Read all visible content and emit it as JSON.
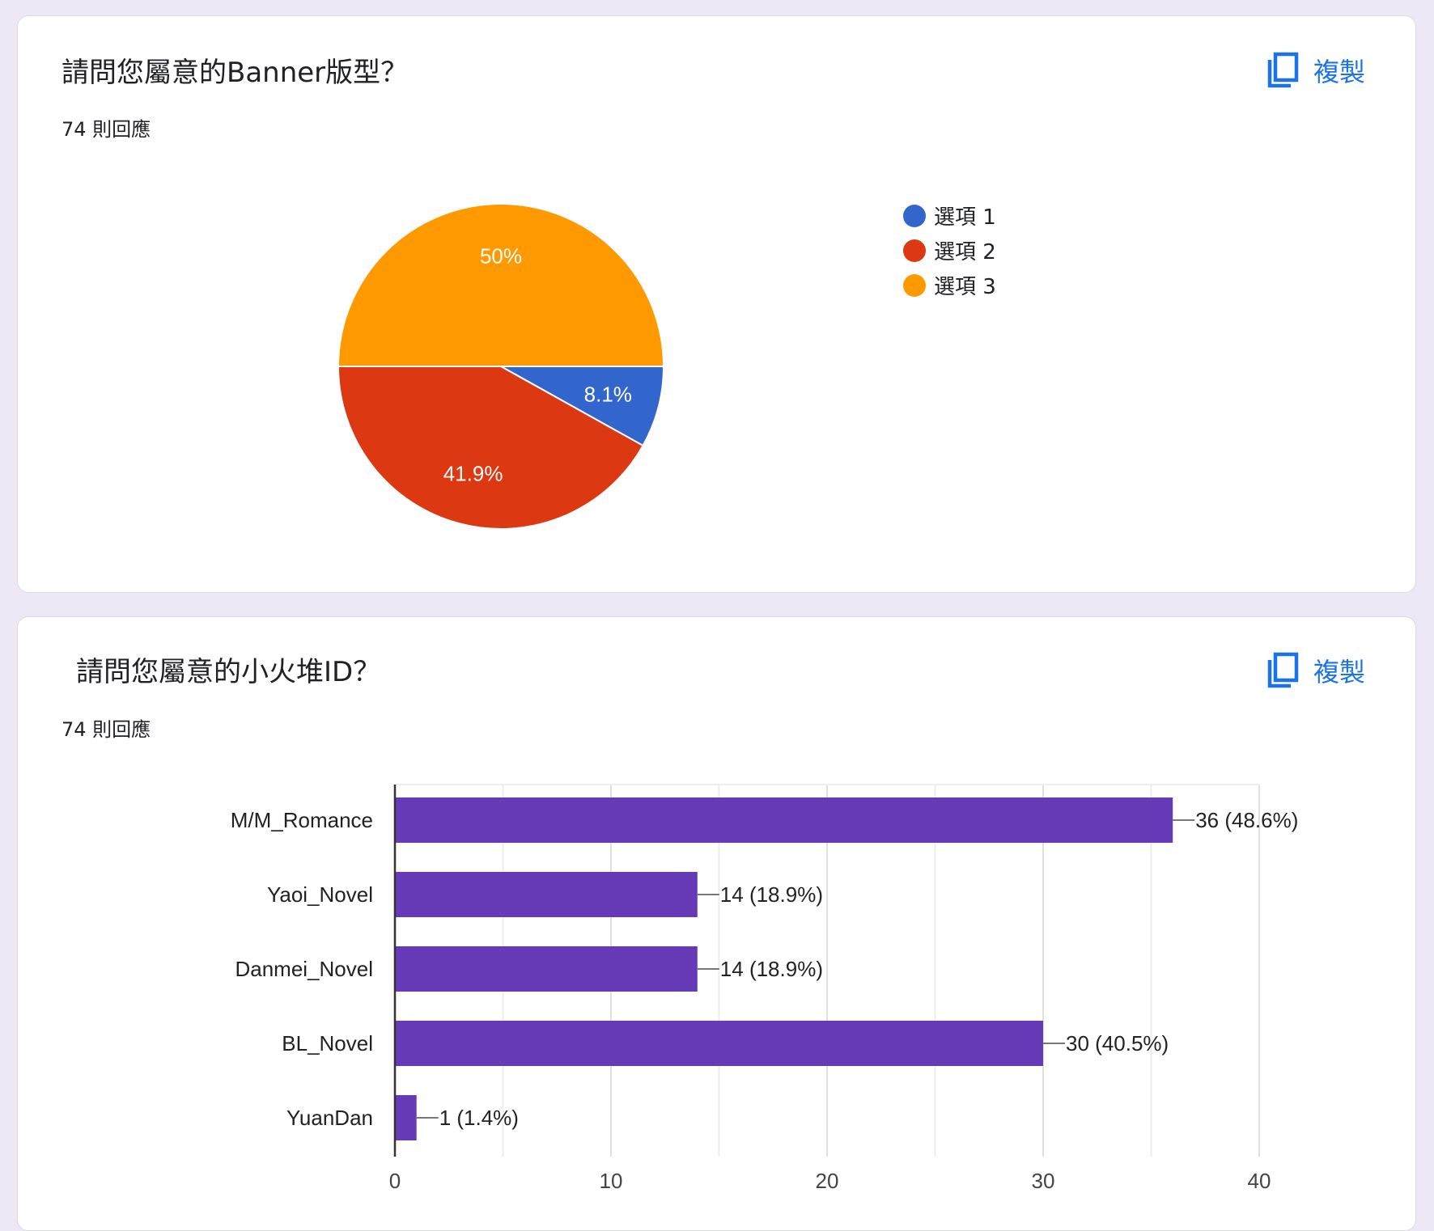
{
  "cards": [
    {
      "title": "請問您屬意的Banner版型？",
      "responses": "74 則回應",
      "copy_label": "複製",
      "chart_data": {
        "type": "pie",
        "slices": [
          {
            "label": "選項 1",
            "value": 8.1,
            "display": "8.1%",
            "color": "#3366cc"
          },
          {
            "label": "選項 2",
            "value": 41.9,
            "display": "41.9%",
            "color": "#dc3912"
          },
          {
            "label": "選項 3",
            "value": 50,
            "display": "50%",
            "color": "#ff9900"
          }
        ],
        "legend_position": "right"
      }
    },
    {
      "title": "請問您屬意的小火堆ID？",
      "responses": "74 則回應",
      "copy_label": "複製",
      "chart_data": {
        "type": "bar",
        "orientation": "horizontal",
        "categories": [
          "M/M_Romance",
          "Yaoi_Novel",
          "Danmei_Novel",
          "BL_Novel",
          "YuanDan"
        ],
        "values": [
          36,
          14,
          14,
          30,
          1
        ],
        "data_labels": [
          "36 (48.6%)",
          "14 (18.9%)",
          "14 (18.9%)",
          "30 (40.5%)",
          "1 (1.4%)"
        ],
        "xlim": [
          0,
          40
        ],
        "x_ticks": [
          0,
          10,
          20,
          30,
          40
        ],
        "bar_color": "#673ab7",
        "grid": true
      }
    }
  ]
}
